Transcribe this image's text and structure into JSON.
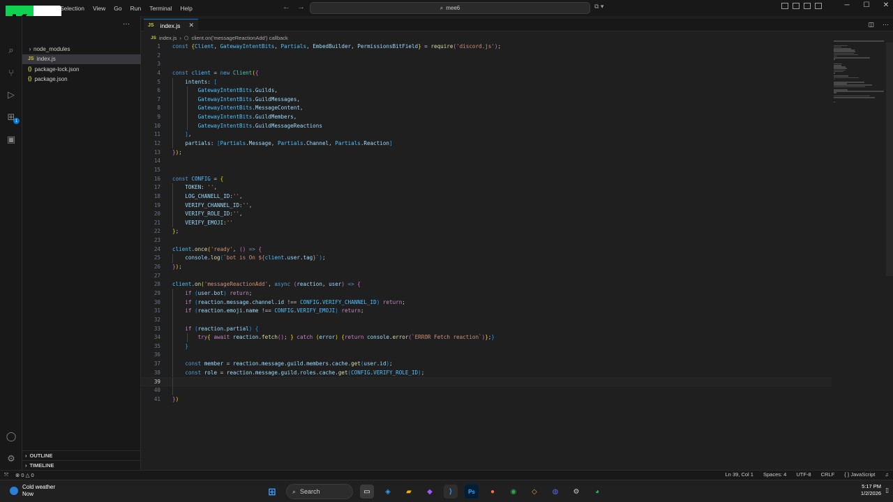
{
  "titlebar": {
    "menu": [
      "Selection",
      "View",
      "Go",
      "Run",
      "Terminal",
      "Help"
    ],
    "search_text": "mee6"
  },
  "logo": {
    "letter": "K",
    "number": "2"
  },
  "sidebar": {
    "files": [
      {
        "name": "node_modules",
        "type": "folder",
        "icon": ""
      },
      {
        "name": "index.js",
        "type": "js",
        "icon": "JS",
        "selected": true
      },
      {
        "name": "package-lock.json",
        "type": "json",
        "icon": "{}"
      },
      {
        "name": "package.json",
        "type": "json",
        "icon": "{}"
      }
    ],
    "outline_label": "OUTLINE",
    "timeline_label": "TIMELINE"
  },
  "editor": {
    "tab_label": "index.js",
    "tab_icon": "JS",
    "breadcrumb_file": "index.js",
    "breadcrumb_symbol": "client.on('messageReactionAdd') callback",
    "current_line": 39,
    "lines": [
      [
        [
          "kw",
          "const "
        ],
        [
          "br1",
          "{"
        ],
        [
          "cst",
          "Client"
        ],
        [
          "pun",
          ", "
        ],
        [
          "cst",
          "GatewayIntentBits"
        ],
        [
          "pun",
          ", "
        ],
        [
          "cst",
          "Partials"
        ],
        [
          "pun",
          ", "
        ],
        [
          "var",
          "EmbedBuilder"
        ],
        [
          "pun",
          ", "
        ],
        [
          "var",
          "PermissionsBitField"
        ],
        [
          "br1",
          "}"
        ],
        [
          "pun",
          " = "
        ],
        [
          "fn",
          "require"
        ],
        [
          "br2",
          "("
        ],
        [
          "str",
          "'discord.js'"
        ],
        [
          "br2",
          ")"
        ],
        [
          "pun",
          ";"
        ]
      ],
      [],
      [],
      [
        [
          "kw",
          "const "
        ],
        [
          "cst",
          "client"
        ],
        [
          "pun",
          " = "
        ],
        [
          "kw",
          "new "
        ],
        [
          "cls",
          "Client"
        ],
        [
          "br1",
          "("
        ],
        [
          "br2",
          "{"
        ]
      ],
      [
        [
          "pun",
          "    "
        ],
        [
          "var",
          "intents"
        ],
        [
          "pun",
          ": "
        ],
        [
          "br3",
          "["
        ]
      ],
      [
        [
          "pun",
          "        "
        ],
        [
          "cst",
          "GatewayIntentBits"
        ],
        [
          "pun",
          "."
        ],
        [
          "var",
          "Guilds"
        ],
        [
          "pun",
          ","
        ]
      ],
      [
        [
          "pun",
          "        "
        ],
        [
          "cst",
          "GatewayIntentBits"
        ],
        [
          "pun",
          "."
        ],
        [
          "var",
          "GuildMessages"
        ],
        [
          "pun",
          ","
        ]
      ],
      [
        [
          "pun",
          "        "
        ],
        [
          "cst",
          "GatewayIntentBits"
        ],
        [
          "pun",
          "."
        ],
        [
          "var",
          "MessageContent"
        ],
        [
          "pun",
          ","
        ]
      ],
      [
        [
          "pun",
          "        "
        ],
        [
          "cst",
          "GatewayIntentBits"
        ],
        [
          "pun",
          "."
        ],
        [
          "var",
          "GuildMembers"
        ],
        [
          "pun",
          ","
        ]
      ],
      [
        [
          "pun",
          "        "
        ],
        [
          "cst",
          "GatewayIntentBits"
        ],
        [
          "pun",
          "."
        ],
        [
          "var",
          "GuildMessageReactions"
        ]
      ],
      [
        [
          "pun",
          "    "
        ],
        [
          "br3",
          "]"
        ],
        [
          "pun",
          ","
        ]
      ],
      [
        [
          "pun",
          "    "
        ],
        [
          "var",
          "partials"
        ],
        [
          "pun",
          ": "
        ],
        [
          "br3",
          "["
        ],
        [
          "cst",
          "Partials"
        ],
        [
          "pun",
          "."
        ],
        [
          "var",
          "Message"
        ],
        [
          "pun",
          ", "
        ],
        [
          "cst",
          "Partials"
        ],
        [
          "pun",
          "."
        ],
        [
          "var",
          "Channel"
        ],
        [
          "pun",
          ", "
        ],
        [
          "cst",
          "Partials"
        ],
        [
          "pun",
          "."
        ],
        [
          "var",
          "Reaction"
        ],
        [
          "br3",
          "]"
        ]
      ],
      [
        [
          "br2",
          "}"
        ],
        [
          "br1",
          ")"
        ],
        [
          "pun",
          ";"
        ]
      ],
      [],
      [],
      [
        [
          "kw",
          "const "
        ],
        [
          "cst",
          "CONFIG"
        ],
        [
          "pun",
          " = "
        ],
        [
          "br1",
          "{"
        ]
      ],
      [
        [
          "pun",
          "    "
        ],
        [
          "var",
          "TOKEN"
        ],
        [
          "pun",
          ": "
        ],
        [
          "str",
          "''"
        ],
        [
          "pun",
          ","
        ]
      ],
      [
        [
          "pun",
          "    "
        ],
        [
          "var",
          "LOG_CHANELL_ID"
        ],
        [
          "pun",
          ":"
        ],
        [
          "str",
          "''"
        ],
        [
          "pun",
          ","
        ]
      ],
      [
        [
          "pun",
          "    "
        ],
        [
          "var",
          "VERIFY_CHANNEL_ID"
        ],
        [
          "pun",
          ":"
        ],
        [
          "str",
          "''"
        ],
        [
          "pun",
          ","
        ]
      ],
      [
        [
          "pun",
          "    "
        ],
        [
          "var",
          "VERIFY_ROLE_ID"
        ],
        [
          "pun",
          ":"
        ],
        [
          "str",
          "''"
        ],
        [
          "pun",
          ","
        ]
      ],
      [
        [
          "pun",
          "    "
        ],
        [
          "var",
          "VERIFY_EMOJI"
        ],
        [
          "pun",
          ":"
        ],
        [
          "str",
          "''"
        ]
      ],
      [
        [
          "br1",
          "}"
        ],
        [
          "pun",
          ";"
        ]
      ],
      [],
      [
        [
          "cst",
          "client"
        ],
        [
          "pun",
          "."
        ],
        [
          "fn",
          "once"
        ],
        [
          "br1",
          "("
        ],
        [
          "str",
          "'ready'"
        ],
        [
          "pun",
          ", "
        ],
        [
          "br2",
          "("
        ],
        [
          "br2",
          ")"
        ],
        [
          "kw",
          " => "
        ],
        [
          "br2",
          "{"
        ]
      ],
      [
        [
          "pun",
          "    "
        ],
        [
          "var",
          "console"
        ],
        [
          "pun",
          "."
        ],
        [
          "fn",
          "log"
        ],
        [
          "br3",
          "("
        ],
        [
          "str",
          "`bot is On ${"
        ],
        [
          "cst",
          "client"
        ],
        [
          "pun",
          "."
        ],
        [
          "var",
          "user"
        ],
        [
          "pun",
          "."
        ],
        [
          "var",
          "tag"
        ],
        [
          "str",
          "}`"
        ],
        [
          "br3",
          ")"
        ],
        [
          "pun",
          ";"
        ]
      ],
      [
        [
          "br2",
          "}"
        ],
        [
          "br1",
          ")"
        ],
        [
          "pun",
          ";"
        ]
      ],
      [],
      [
        [
          "cst",
          "client"
        ],
        [
          "pun",
          "."
        ],
        [
          "fn",
          "on"
        ],
        [
          "br1",
          "("
        ],
        [
          "str",
          "'messageReactionAdd'"
        ],
        [
          "pun",
          ", "
        ],
        [
          "kw",
          "async "
        ],
        [
          "br2",
          "("
        ],
        [
          "var",
          "reaction"
        ],
        [
          "pun",
          ", "
        ],
        [
          "var",
          "user"
        ],
        [
          "br2",
          ")"
        ],
        [
          "kw",
          " => "
        ],
        [
          "br2",
          "{"
        ]
      ],
      [
        [
          "pun",
          "    "
        ],
        [
          "ctl",
          "if "
        ],
        [
          "br3",
          "("
        ],
        [
          "var",
          "user"
        ],
        [
          "pun",
          "."
        ],
        [
          "var",
          "bot"
        ],
        [
          "br3",
          ")"
        ],
        [
          "ctl",
          " return"
        ],
        [
          "pun",
          ";"
        ]
      ],
      [
        [
          "pun",
          "    "
        ],
        [
          "ctl",
          "if "
        ],
        [
          "br3",
          "("
        ],
        [
          "var",
          "reaction"
        ],
        [
          "pun",
          "."
        ],
        [
          "var",
          "message"
        ],
        [
          "pun",
          "."
        ],
        [
          "var",
          "channel"
        ],
        [
          "pun",
          "."
        ],
        [
          "var",
          "id"
        ],
        [
          "pun",
          " !== "
        ],
        [
          "cst",
          "CONFIG"
        ],
        [
          "pun",
          "."
        ],
        [
          "cst",
          "VERIFY_CHANNEL_ID"
        ],
        [
          "br3",
          ")"
        ],
        [
          "ctl",
          " return"
        ],
        [
          "pun",
          ";"
        ]
      ],
      [
        [
          "pun",
          "    "
        ],
        [
          "ctl",
          "if "
        ],
        [
          "br3",
          "("
        ],
        [
          "var",
          "reaction"
        ],
        [
          "pun",
          "."
        ],
        [
          "var",
          "emoji"
        ],
        [
          "pun",
          "."
        ],
        [
          "var",
          "name"
        ],
        [
          "pun",
          " !== "
        ],
        [
          "cst",
          "CONFIG"
        ],
        [
          "pun",
          "."
        ],
        [
          "cst",
          "VERIFY_EMOJI"
        ],
        [
          "br3",
          ")"
        ],
        [
          "ctl",
          " return"
        ],
        [
          "pun",
          ";"
        ]
      ],
      [],
      [
        [
          "pun",
          "    "
        ],
        [
          "ctl",
          "if "
        ],
        [
          "br3",
          "("
        ],
        [
          "var",
          "reaction"
        ],
        [
          "pun",
          "."
        ],
        [
          "var",
          "partial"
        ],
        [
          "br3",
          ")"
        ],
        [
          "pun",
          " "
        ],
        [
          "br3",
          "{"
        ]
      ],
      [
        [
          "pun",
          "        "
        ],
        [
          "ctl",
          "try"
        ],
        [
          "br1",
          "{"
        ],
        [
          "pun",
          " "
        ],
        [
          "ctl",
          "await "
        ],
        [
          "var",
          "reaction"
        ],
        [
          "pun",
          "."
        ],
        [
          "fn",
          "fetch"
        ],
        [
          "br2",
          "("
        ],
        [
          "br2",
          ")"
        ],
        [
          "pun",
          "; "
        ],
        [
          "br1",
          "}"
        ],
        [
          "ctl",
          " catch "
        ],
        [
          "br1",
          "("
        ],
        [
          "var",
          "error"
        ],
        [
          "br1",
          ")"
        ],
        [
          "pun",
          " "
        ],
        [
          "br1",
          "{"
        ],
        [
          "ctl",
          "return "
        ],
        [
          "var",
          "console"
        ],
        [
          "pun",
          "."
        ],
        [
          "fn",
          "error"
        ],
        [
          "br2",
          "("
        ],
        [
          "str",
          "`ERROR Fetch reaction`"
        ],
        [
          "br2",
          ")"
        ],
        [
          "br1",
          "}"
        ],
        [
          "pun",
          ";"
        ],
        [
          "br3",
          "}"
        ]
      ],
      [
        [
          "pun",
          "    "
        ],
        [
          "br3",
          "}"
        ]
      ],
      [],
      [
        [
          "pun",
          "    "
        ],
        [
          "kw",
          "const "
        ],
        [
          "var",
          "member"
        ],
        [
          "pun",
          " = "
        ],
        [
          "var",
          "reaction"
        ],
        [
          "pun",
          "."
        ],
        [
          "var",
          "message"
        ],
        [
          "pun",
          "."
        ],
        [
          "var",
          "guild"
        ],
        [
          "pun",
          "."
        ],
        [
          "var",
          "members"
        ],
        [
          "pun",
          "."
        ],
        [
          "var",
          "cache"
        ],
        [
          "pun",
          "."
        ],
        [
          "fn",
          "get"
        ],
        [
          "br3",
          "("
        ],
        [
          "var",
          "user"
        ],
        [
          "pun",
          "."
        ],
        [
          "var",
          "id"
        ],
        [
          "br3",
          ")"
        ],
        [
          "pun",
          ";"
        ]
      ],
      [
        [
          "pun",
          "    "
        ],
        [
          "kw",
          "const "
        ],
        [
          "var",
          "role"
        ],
        [
          "pun",
          " = "
        ],
        [
          "var",
          "reaction"
        ],
        [
          "pun",
          "."
        ],
        [
          "var",
          "message"
        ],
        [
          "pun",
          "."
        ],
        [
          "var",
          "guild"
        ],
        [
          "pun",
          "."
        ],
        [
          "var",
          "roles"
        ],
        [
          "pun",
          "."
        ],
        [
          "var",
          "cache"
        ],
        [
          "pun",
          "."
        ],
        [
          "fn",
          "get"
        ],
        [
          "br3",
          "("
        ],
        [
          "cst",
          "CONFIG"
        ],
        [
          "pun",
          "."
        ],
        [
          "cst",
          "VERIFY_ROLE_ID"
        ],
        [
          "br3",
          ")"
        ],
        [
          "pun",
          ";"
        ]
      ],
      [],
      [],
      [
        [
          "br2",
          "}"
        ],
        [
          "br1",
          ")"
        ]
      ]
    ]
  },
  "statusbar": {
    "errors": "0",
    "warnings": "0",
    "position": "Ln 39, Col 1",
    "spaces": "Spaces: 4",
    "encoding": "UTF-8",
    "eol": "CRLF",
    "language": "JavaScript"
  },
  "taskbar": {
    "weather_title": "Cold weather",
    "weather_sub": "Now",
    "search_label": "Search",
    "time": "5:17 PM",
    "date": "1/2/2026"
  }
}
